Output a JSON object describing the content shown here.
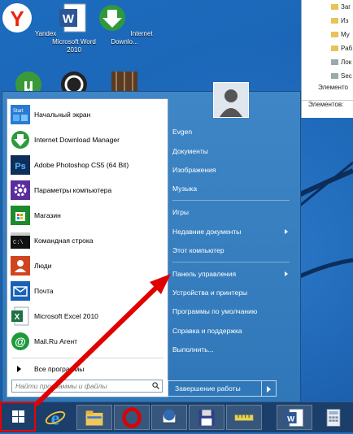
{
  "desktop": {
    "icons": [
      {
        "label": "Yandex",
        "icon": "yandex-icon"
      },
      {
        "label": "Microsoft Word 2010",
        "icon": "word-icon"
      },
      {
        "label": "Internet Downlo...",
        "icon": "idm-icon"
      }
    ]
  },
  "explorer": {
    "rows": [
      "Заг",
      "Из",
      "Му",
      "Раб",
      "Лок",
      "Sec"
    ],
    "status_top": "Элементо",
    "status_bottom": "Элементов:"
  },
  "start_menu": {
    "apps": [
      {
        "label": "Начальный экран",
        "icon": "start-screen-icon",
        "badge": "Start"
      },
      {
        "label": "Internet Download Manager",
        "icon": "idm-icon"
      },
      {
        "label": "Adobe Photoshop CS5 (64 Bit)",
        "icon": "photoshop-icon",
        "badge": "Ps"
      },
      {
        "label": "Параметры компьютера",
        "icon": "settings-gear-icon"
      },
      {
        "label": "Магазин",
        "icon": "store-icon"
      },
      {
        "label": "Командная строка",
        "icon": "command-prompt-icon"
      },
      {
        "label": "Люди",
        "icon": "people-icon"
      },
      {
        "label": "Почта",
        "icon": "mail-icon"
      },
      {
        "label": "Microsoft Excel 2010",
        "icon": "excel-icon"
      },
      {
        "label": "Mail.Ru Агент",
        "icon": "mailru-agent-icon"
      }
    ],
    "all_programs": "Все программы",
    "search_placeholder": "Найти программы и файлы",
    "right_items": [
      {
        "label": "Evgen",
        "arrow": false
      },
      {
        "label": "Документы",
        "arrow": false
      },
      {
        "label": "Изображения",
        "arrow": false
      },
      {
        "label": "Музыка",
        "arrow": false
      },
      {
        "label": "Игры",
        "arrow": false
      },
      {
        "label": "Недавние документы",
        "arrow": true
      },
      {
        "label": "Этот компьютер",
        "arrow": false
      },
      {
        "label": "Панель управления",
        "arrow": true
      },
      {
        "label": "Устройства и принтеры",
        "arrow": false
      },
      {
        "label": "Программы по умолчанию",
        "arrow": false
      },
      {
        "label": "Справка и поддержка",
        "arrow": false
      },
      {
        "label": "Выполнить...",
        "arrow": false
      }
    ],
    "shutdown_label": "Завершение работы"
  },
  "taskbar": {
    "items": [
      "start-button",
      "internet-explorer-icon",
      "file-explorer-icon",
      "opera-icon",
      "thunderbird-icon",
      "save-floppy-icon",
      "ruler-icon",
      "word-icon",
      "calculator-icon"
    ]
  },
  "colors": {
    "accent": "#2f77b8",
    "highlight_arrow": "#e00000"
  }
}
